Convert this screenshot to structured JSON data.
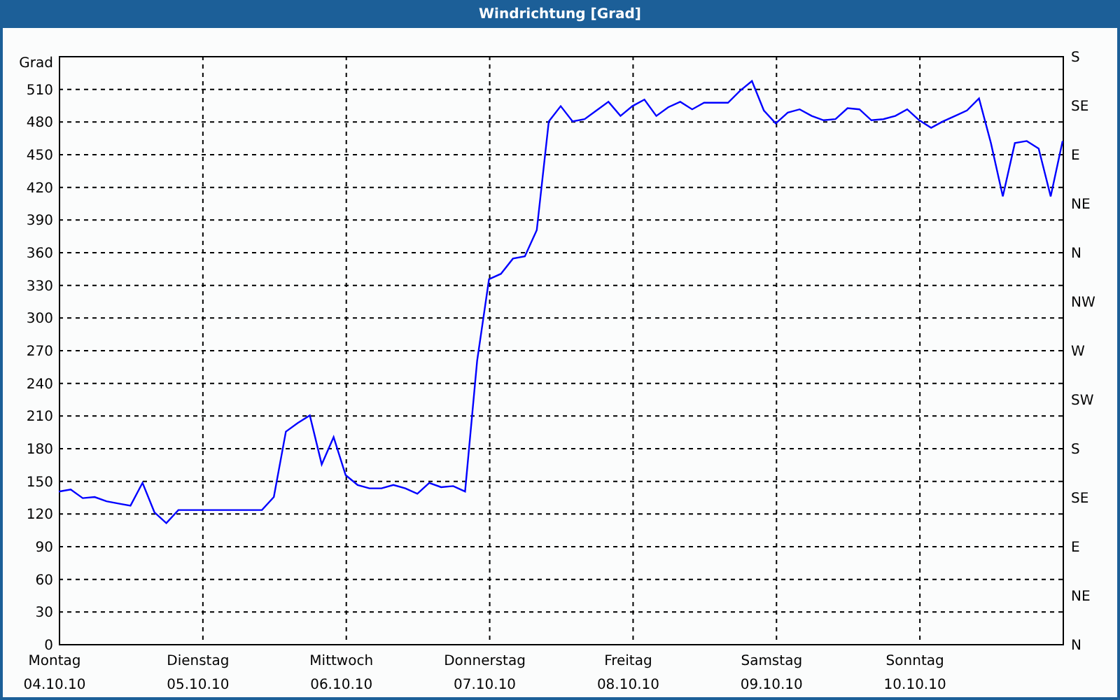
{
  "window": {
    "title": "Windrichtung [Grad]"
  },
  "chart": {
    "chart_data": {
      "type": "line",
      "grid": true,
      "ylabel": "Grad",
      "ylim": [
        0,
        540
      ],
      "yticks": [
        0,
        30,
        60,
        90,
        120,
        150,
        180,
        210,
        240,
        270,
        300,
        330,
        360,
        390,
        420,
        450,
        480,
        510
      ],
      "categories": [
        "Montag",
        null,
        null,
        null,
        null,
        null,
        null,
        null,
        null,
        null,
        null,
        null,
        "Dienstag",
        null,
        null,
        null,
        null,
        null,
        null,
        null,
        null,
        null,
        null,
        null,
        "Mittwoch",
        null,
        null,
        null,
        null,
        null,
        null,
        null,
        null,
        null,
        null,
        null,
        "Donnerstag",
        null,
        null,
        null,
        null,
        null,
        null,
        null,
        null,
        null,
        null,
        null,
        "Freitag",
        null,
        null,
        null,
        null,
        null,
        null,
        null,
        null,
        null,
        null,
        null,
        "Samstag",
        null,
        null,
        null,
        null,
        null,
        null,
        null,
        null,
        null,
        null,
        null,
        "Sonntag",
        null,
        null,
        null,
        null,
        null,
        null,
        null,
        null,
        null,
        null,
        null,
        null
      ],
      "series": [
        {
          "color": "#0000ff",
          "values": [
            140,
            142,
            134,
            135,
            131,
            129,
            127,
            148,
            121,
            111,
            123,
            123,
            123,
            123,
            123,
            123,
            123,
            123,
            135,
            195,
            203,
            210,
            165,
            190,
            155,
            146,
            143,
            143,
            146,
            143,
            138,
            148,
            144,
            145,
            140,
            260,
            335,
            340,
            354,
            356,
            380,
            480,
            494,
            480,
            482,
            490,
            498,
            485,
            494,
            500,
            485,
            493,
            498,
            491,
            497,
            497,
            497,
            508,
            517,
            490,
            478,
            488,
            491,
            485,
            481,
            482,
            492,
            491,
            481,
            482,
            485,
            491,
            481,
            474,
            480,
            485,
            490,
            501,
            460,
            411,
            460,
            462,
            455,
            411,
            462
          ]
        }
      ]
    },
    "x_tick_dates": [
      "04.10.10",
      "05.10.10",
      "06.10.10",
      "07.10.10",
      "08.10.10",
      "09.10.10",
      "10.10.10"
    ],
    "compass_labels": [
      "S",
      "SE",
      "E",
      "NE",
      "N",
      "NW",
      "W",
      "SW",
      "S",
      "SE",
      "E",
      "NE",
      "N"
    ]
  }
}
